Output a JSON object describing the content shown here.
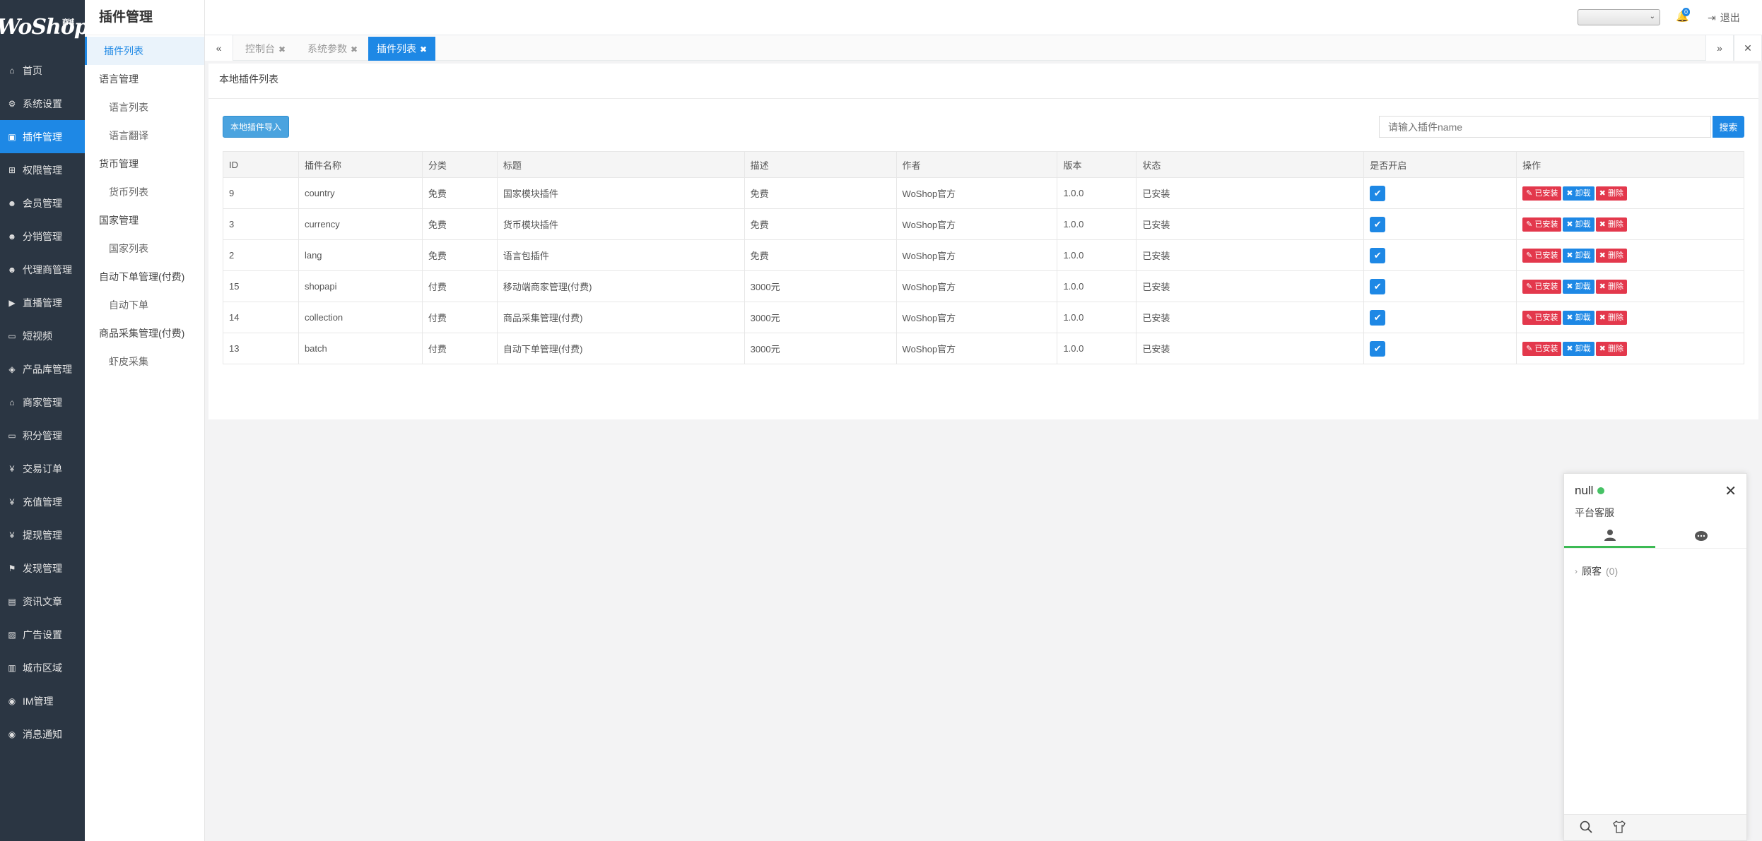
{
  "brand": {
    "logo": "WoShop",
    "logo_sup": "商城"
  },
  "nav": [
    {
      "label": "首页",
      "icon": "home-icon",
      "glyph": "⌂"
    },
    {
      "label": "系统设置",
      "icon": "gear-icon",
      "glyph": "⚙"
    },
    {
      "label": "插件管理",
      "icon": "plugin-icon",
      "glyph": "▣",
      "active": true
    },
    {
      "label": "权限管理",
      "icon": "sitemap-icon",
      "glyph": "⊞"
    },
    {
      "label": "会员管理",
      "icon": "users-icon",
      "glyph": "☻"
    },
    {
      "label": "分销管理",
      "icon": "users-icon",
      "glyph": "☻"
    },
    {
      "label": "代理商管理",
      "icon": "users-icon",
      "glyph": "☻"
    },
    {
      "label": "直播管理",
      "icon": "video-icon",
      "glyph": "▶"
    },
    {
      "label": "短视频",
      "icon": "file-icon",
      "glyph": "▭"
    },
    {
      "label": "产品库管理",
      "icon": "cube-icon",
      "glyph": "◈"
    },
    {
      "label": "商家管理",
      "icon": "bank-icon",
      "glyph": "⌂"
    },
    {
      "label": "积分管理",
      "icon": "file-icon",
      "glyph": "▭"
    },
    {
      "label": "交易订单",
      "icon": "yen-icon",
      "glyph": "¥"
    },
    {
      "label": "充值管理",
      "icon": "yen-icon",
      "glyph": "¥"
    },
    {
      "label": "提现管理",
      "icon": "yen-icon",
      "glyph": "¥"
    },
    {
      "label": "发现管理",
      "icon": "flag-icon",
      "glyph": "⚑"
    },
    {
      "label": "资讯文章",
      "icon": "newspaper-icon",
      "glyph": "▤"
    },
    {
      "label": "广告设置",
      "icon": "image-icon",
      "glyph": "▨"
    },
    {
      "label": "城市区域",
      "icon": "map-icon",
      "glyph": "▥"
    },
    {
      "label": "IM管理",
      "icon": "comments-icon",
      "glyph": "◉"
    },
    {
      "label": "消息通知",
      "icon": "comment-icon",
      "glyph": "◉"
    }
  ],
  "subnav": {
    "title": "插件管理",
    "items": [
      {
        "label": "插件列表",
        "level": 2,
        "active": true
      },
      {
        "label": "语言管理",
        "level": 1
      },
      {
        "label": "语言列表",
        "level": 2
      },
      {
        "label": "语言翻译",
        "level": 2
      },
      {
        "label": "货币管理",
        "level": 1
      },
      {
        "label": "货币列表",
        "level": 2
      },
      {
        "label": "国家管理",
        "level": 1
      },
      {
        "label": "国家列表",
        "level": 2
      },
      {
        "label": "自动下单管理(付费)",
        "level": 1
      },
      {
        "label": "自动下单",
        "level": 2
      },
      {
        "label": "商品采集管理(付费)",
        "level": 1
      },
      {
        "label": "虾皮采集",
        "level": 2
      }
    ]
  },
  "topbar": {
    "notif_count": "0",
    "logout": "退出"
  },
  "tabs": [
    {
      "label": "控制台",
      "active": false
    },
    {
      "label": "系统参数",
      "active": false
    },
    {
      "label": "插件列表",
      "active": true
    }
  ],
  "panel": {
    "title": "本地插件列表",
    "import_button": "本地插件导入",
    "search_placeholder": "请输入插件name",
    "search_button": "搜索"
  },
  "table": {
    "columns": [
      "ID",
      "插件名称",
      "分类",
      "标题",
      "描述",
      "作者",
      "版本",
      "状态",
      "是否开启",
      "操作"
    ],
    "rows": [
      {
        "id": "9",
        "name": "country",
        "category": "免费",
        "title": "国家模块插件",
        "desc": "免费",
        "author": "WoShop官方",
        "version": "1.0.0",
        "status": "已安装"
      },
      {
        "id": "3",
        "name": "currency",
        "category": "免费",
        "title": "货币模块插件",
        "desc": "免费",
        "author": "WoShop官方",
        "version": "1.0.0",
        "status": "已安装"
      },
      {
        "id": "2",
        "name": "lang",
        "category": "免费",
        "title": "语言包插件",
        "desc": "免费",
        "author": "WoShop官方",
        "version": "1.0.0",
        "status": "已安装"
      },
      {
        "id": "15",
        "name": "shopapi",
        "category": "付费",
        "title": "移动端商家管理(付费)",
        "desc": "3000元",
        "author": "WoShop官方",
        "version": "1.0.0",
        "status": "已安装"
      },
      {
        "id": "14",
        "name": "collection",
        "category": "付费",
        "title": "商品采集管理(付费)",
        "desc": "3000元",
        "author": "WoShop官方",
        "version": "1.0.0",
        "status": "已安装"
      },
      {
        "id": "13",
        "name": "batch",
        "category": "付费",
        "title": "自动下单管理(付费)",
        "desc": "3000元",
        "author": "WoShop官方",
        "version": "1.0.0",
        "status": "已安装"
      }
    ],
    "actions": {
      "installed": "已安装",
      "uninstall": "卸载",
      "delete": "删除"
    }
  },
  "chat": {
    "name": "null",
    "subtitle": "平台客服",
    "group_label": "顾客",
    "group_count": "(0)",
    "status_color": "#46c265"
  },
  "colors": {
    "accent": "#1e88e5",
    "sidebar_bg": "#2b3643",
    "danger": "#e3384c"
  }
}
